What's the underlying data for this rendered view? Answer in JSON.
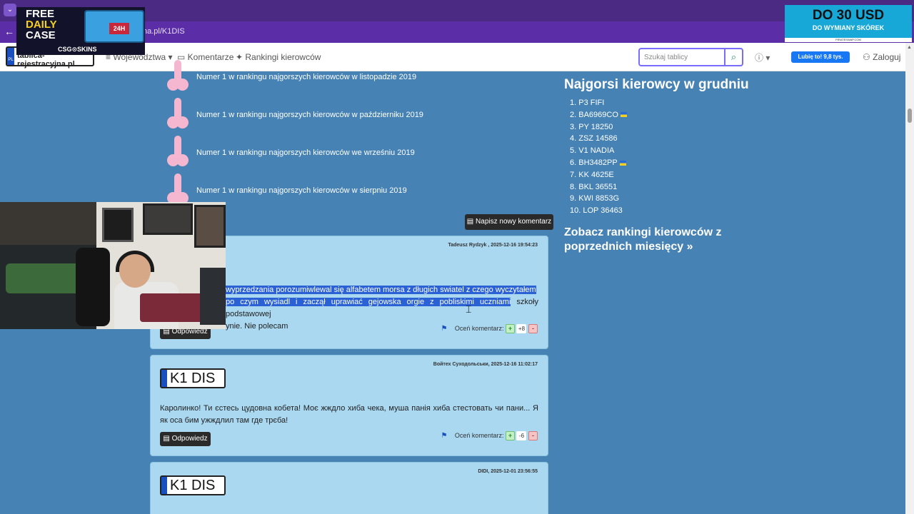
{
  "browser": {
    "url": "na.pl/K1DIS"
  },
  "navbar": {
    "logo": "tablica-rejestracyjna.pl",
    "logo_flag": "PL",
    "links": [
      "Województwa",
      "Komentarze",
      "Rankingi kierowców"
    ],
    "search_placeholder": "Szukaj tablicy",
    "help": "?",
    "fb_like": "Lubię to! 9,8 tys.",
    "login": "Zaloguj"
  },
  "rankings": [
    "Numer 1 w rankingu najgorszych kierowców w listopadzie 2019",
    "Numer 1 w rankingu najgorszych kierowców w październiku 2019",
    "Numer 1 w rankingu najgorszych kierowców we wrześniu 2019",
    "Numer 1 w rankingu najgorszych kierowców w sierpniu 2019"
  ],
  "new_comment_label": "Napisz nowy komentarz",
  "comments": [
    {
      "author": "Tadeusz Rydzyk , 2025-12-16 19:54:23",
      "line1": "wyprzedzania porozumiwlewal się alfabetem morsa z długich swiatel z czego wyczytałem",
      "line2a": "po czym wysiadl i zaczął uprawiać gejowska orgie z pobliskimi uczniami",
      "line2b": " szkoły podstawowej",
      "line3": "ynie. Nie polecam",
      "reply": "Odpowiedz",
      "rate_label": "Oceń komentarz:",
      "score": "+8"
    },
    {
      "author": "Войтех Суходольськи, 2025-12-16 11:02:17",
      "plate": "K1 DIS",
      "text": "Каролинко! Ти єстесь цудовна кобета! Моє жждло хиба чека, муша панія хиба стестовать чи пани... Я як оса бим ужждлил там где трєба!",
      "reply": "Odpowiedz",
      "rate_label": "Oceń komentarz:",
      "score": "-6"
    },
    {
      "author": "DIDI, 2025-12-01 23:56:55",
      "plate": "K1 DIS"
    }
  ],
  "sidebar": {
    "title": "Najgorsi kierowcy w grudniu",
    "items": [
      "1. P3 FIFI",
      "2. BA6969CO",
      "3. PY 18250",
      "4. ZSZ 14586",
      "5. V1 NADIA",
      "6. BH3482PP",
      "7. KK 4625E",
      "8. BKL 36551",
      "9. KWI 8853G",
      "10. LOP 36463"
    ],
    "more": "Zobacz rankingi kierowców z poprzednich miesięcy »"
  },
  "promo": {
    "free": "FREE",
    "daily": "DAILY",
    "case": "CASE",
    "h24": "24H",
    "brand": "CSG⊙SKINS"
  },
  "ad": {
    "line1": "DO 30 USD",
    "line2": "DO WYMIANY SKÓREK",
    "line3": "PIRATESWAP.COM"
  },
  "colors": {
    "page_bg": "#4682b4",
    "comment_bg": "#a9d8f0",
    "browser_tab": "#4a2a82",
    "browser_address": "#5b2ea8"
  }
}
